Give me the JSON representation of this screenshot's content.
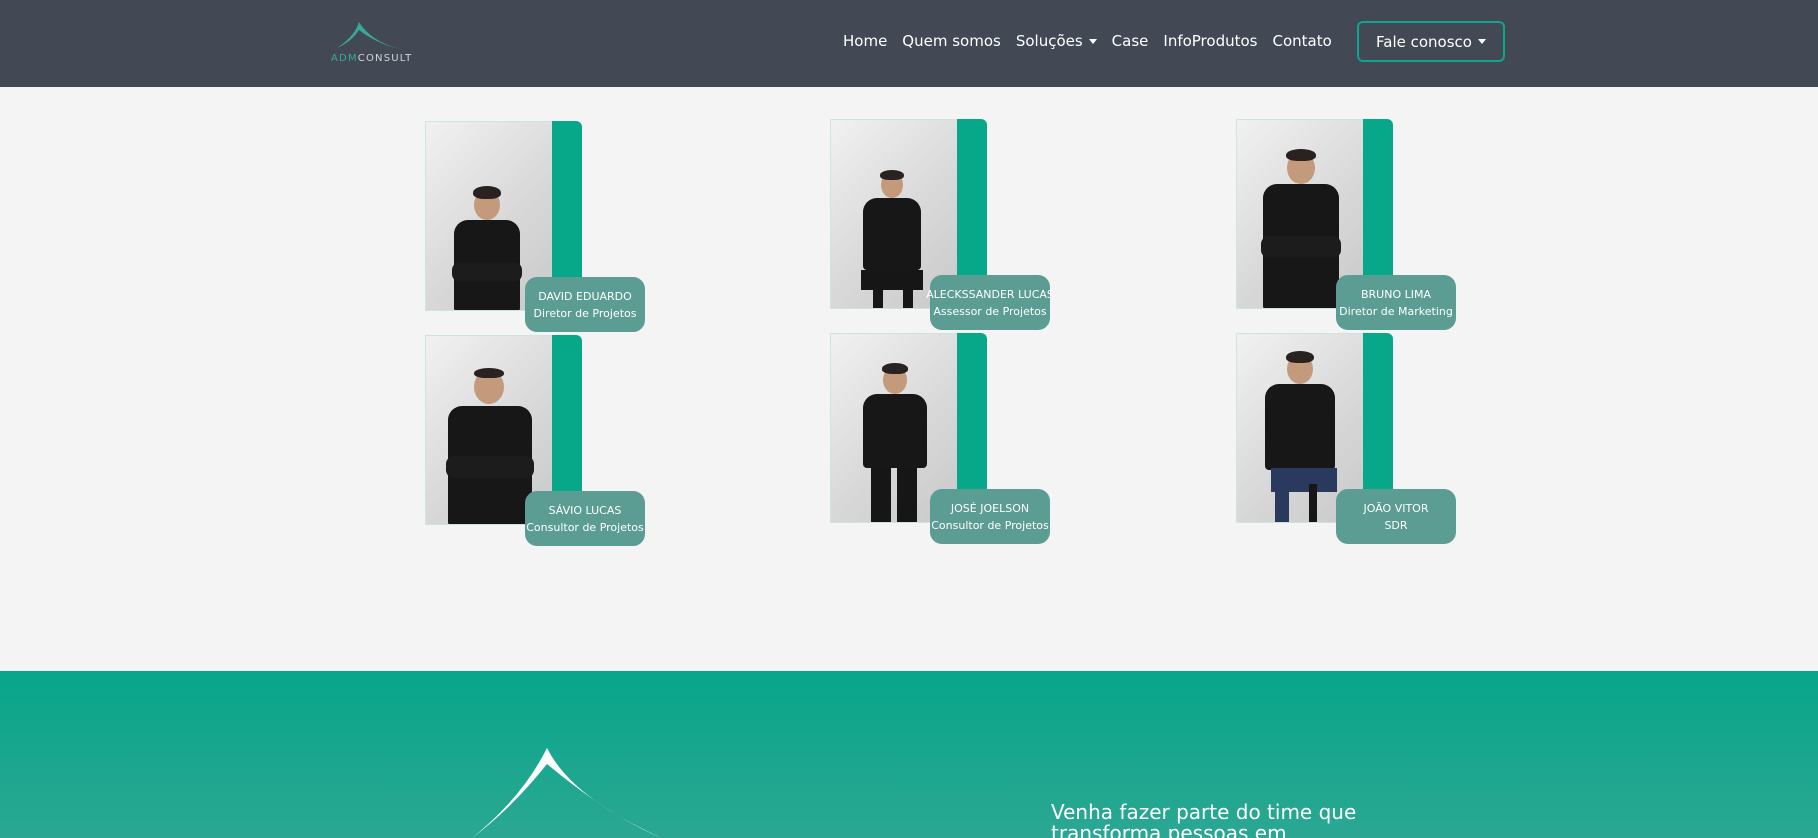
{
  "brand": {
    "logo_prefix": "ADM",
    "logo_suffix": "CONSULT"
  },
  "nav": {
    "items": [
      {
        "label": "Home"
      },
      {
        "label": "Quem somos"
      },
      {
        "label": "Soluções"
      },
      {
        "label": "Case"
      },
      {
        "label": "InfoProdutos"
      },
      {
        "label": "Contato"
      }
    ],
    "cta_label": "Fale conosco"
  },
  "team": [
    {
      "name": "DAVID EDUARDO",
      "role": "Diretor de Projetos"
    },
    {
      "name": "ALECKSSANDER LUCAS",
      "role": "Assessor de Projetos"
    },
    {
      "name": "BRUNO LIMA",
      "role": "Diretor de Marketing"
    },
    {
      "name": "SÁVIO LUCAS",
      "role": "Consultor de Projetos"
    },
    {
      "name": "JOSÉ JOELSON",
      "role": "Consultor de Projetos"
    },
    {
      "name": "JOÃO VITOR",
      "role": "SDR"
    }
  ],
  "footer": {
    "text_line1": "Venha fazer parte do time que",
    "text_line2": "transforma pessoas em"
  },
  "colors": {
    "navbar": "#424955",
    "accent": "#07a88a",
    "label_bg": "#5b9c93",
    "page_bg": "#f4f4f4"
  }
}
